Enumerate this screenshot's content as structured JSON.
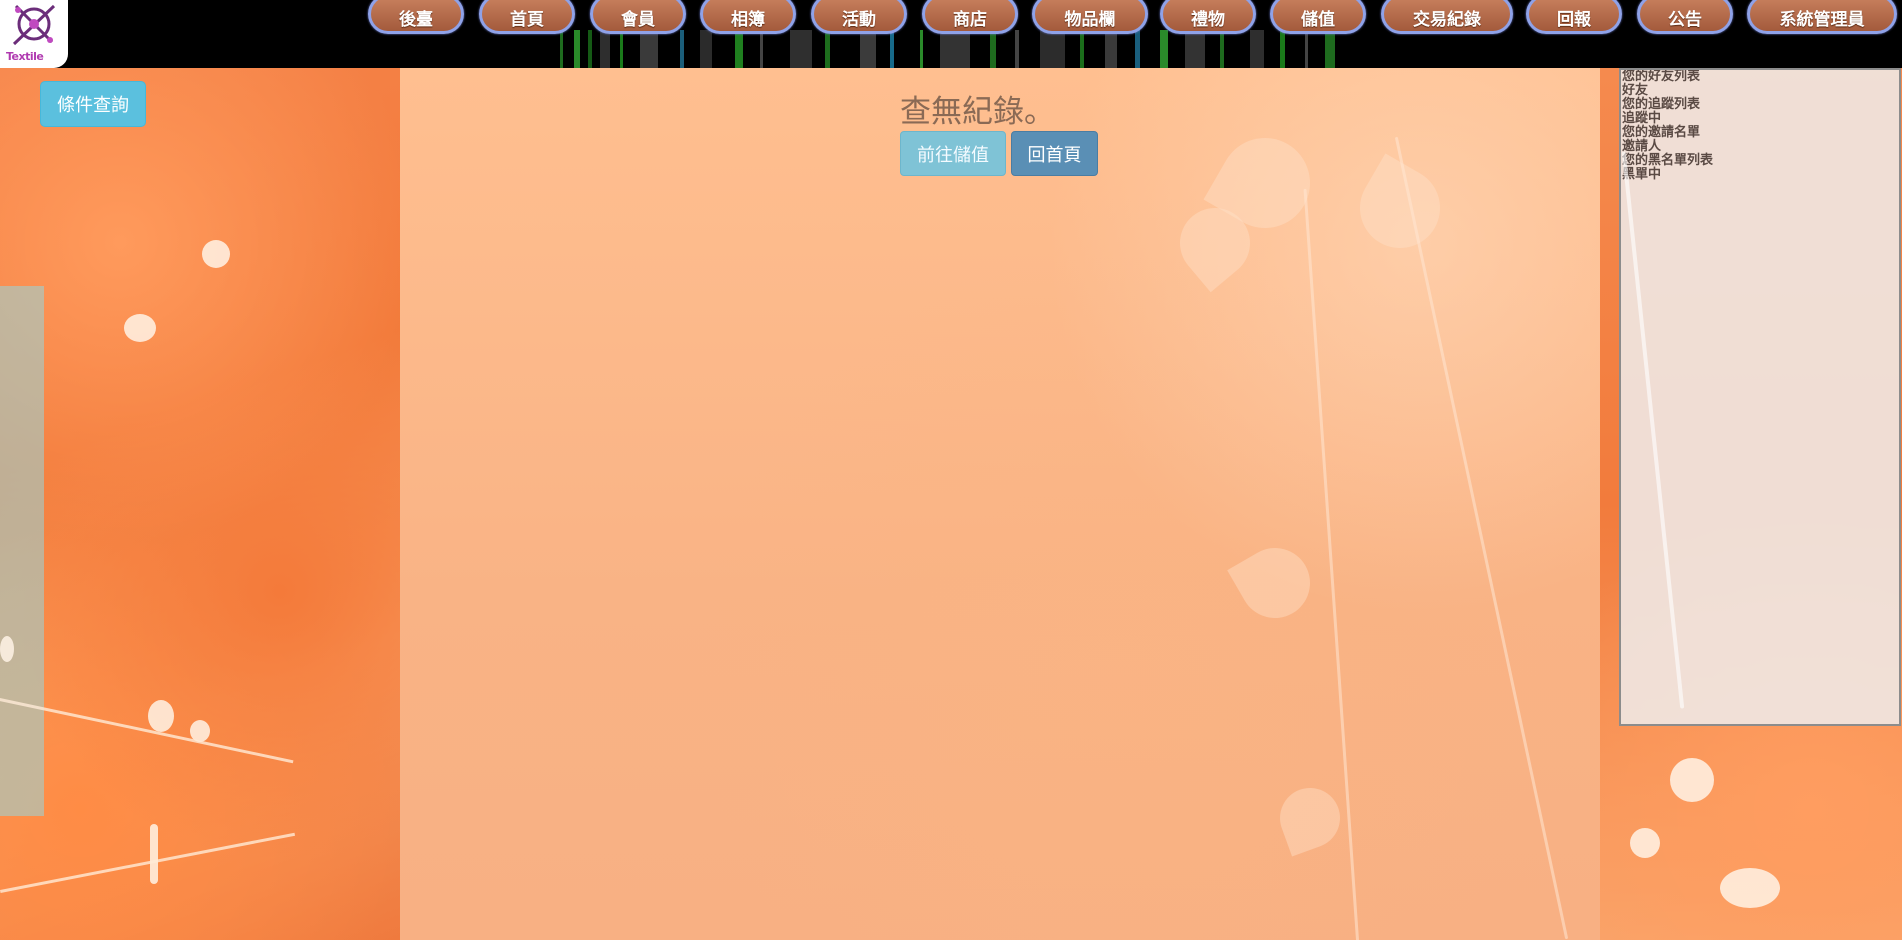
{
  "logo": {
    "text": "Textile"
  },
  "nav": {
    "items": [
      "後臺",
      "首頁",
      "會員",
      "相簿",
      "活動",
      "商店",
      "物品欄",
      "禮物",
      "儲值",
      "交易紀錄",
      "回報",
      "公告",
      "系統管理員"
    ]
  },
  "sidebar": {
    "query_button": "條件查詢"
  },
  "main": {
    "message": "查無紀錄。",
    "deposit_button": "前往儲值",
    "home_button": "回首頁"
  },
  "friends_panel": {
    "lines": [
      "您的好友列表",
      "好友",
      "您的追蹤列表",
      "追蹤中",
      "您的邀請名單",
      "邀請人",
      "您的黑名單列表",
      "黑單中"
    ]
  },
  "colors": {
    "nav_button_bg": "#b5694a",
    "nav_button_border": "#8fa2e8",
    "info_button": "#5bc0de",
    "primary_button": "#5a8fb5",
    "background": "#f9b385"
  }
}
